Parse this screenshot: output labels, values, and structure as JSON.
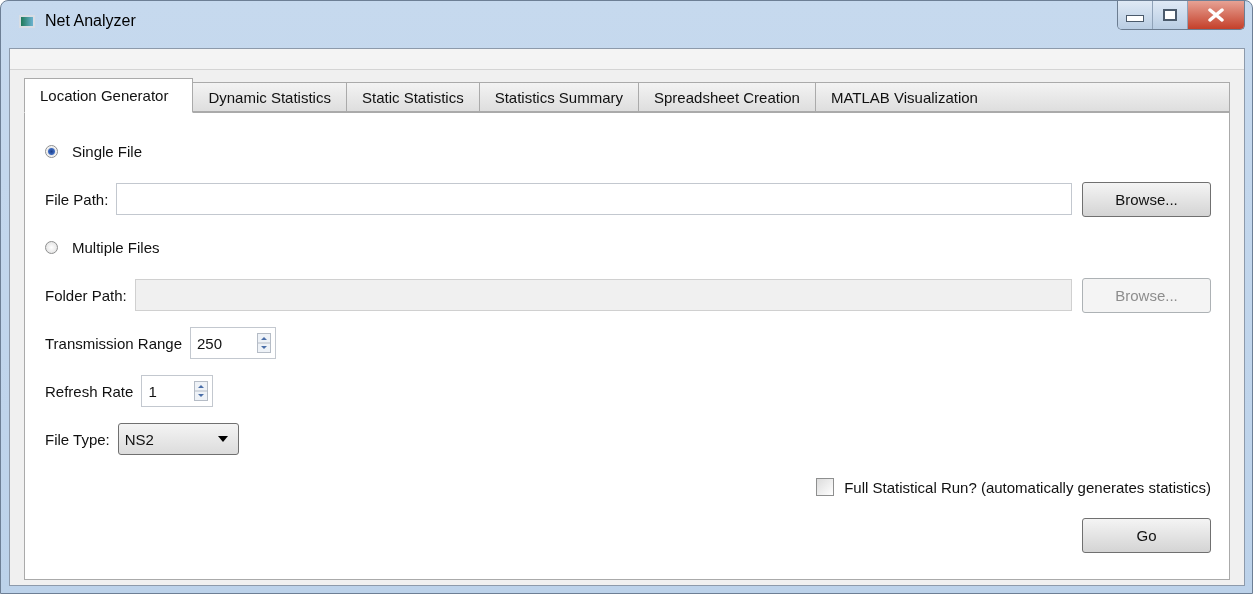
{
  "window": {
    "title": "Net Analyzer"
  },
  "tabs": [
    {
      "label": "Location Generator",
      "selected": true
    },
    {
      "label": "Dynamic Statistics",
      "selected": false
    },
    {
      "label": "Static Statistics",
      "selected": false
    },
    {
      "label": "Statistics Summary",
      "selected": false
    },
    {
      "label": "Spreadsheet Creation",
      "selected": false
    },
    {
      "label": "MATLAB Visualization",
      "selected": false
    }
  ],
  "rows": [
    {
      "kind": "radio",
      "label": "Single File",
      "selected": true
    },
    {
      "kind": "path",
      "label": "File Path:",
      "disabled": false,
      "button": "Browse..."
    },
    {
      "kind": "radio",
      "label": "Multiple Files",
      "selected": false
    },
    {
      "kind": "path",
      "label": "Folder Path:",
      "disabled": true,
      "button": "Browse..."
    },
    {
      "kind": "spin",
      "label": "Transmission Range",
      "value": "250"
    },
    {
      "kind": "spin",
      "label": "Refresh Rate",
      "value": "1"
    },
    {
      "kind": "combo",
      "label": "File Type:",
      "value": "NS2"
    },
    {
      "kind": "checkbox",
      "label": "Full Statistical Run? (automatically generates statistics)",
      "checked": false
    },
    {
      "kind": "button",
      "label": "Go"
    }
  ]
}
